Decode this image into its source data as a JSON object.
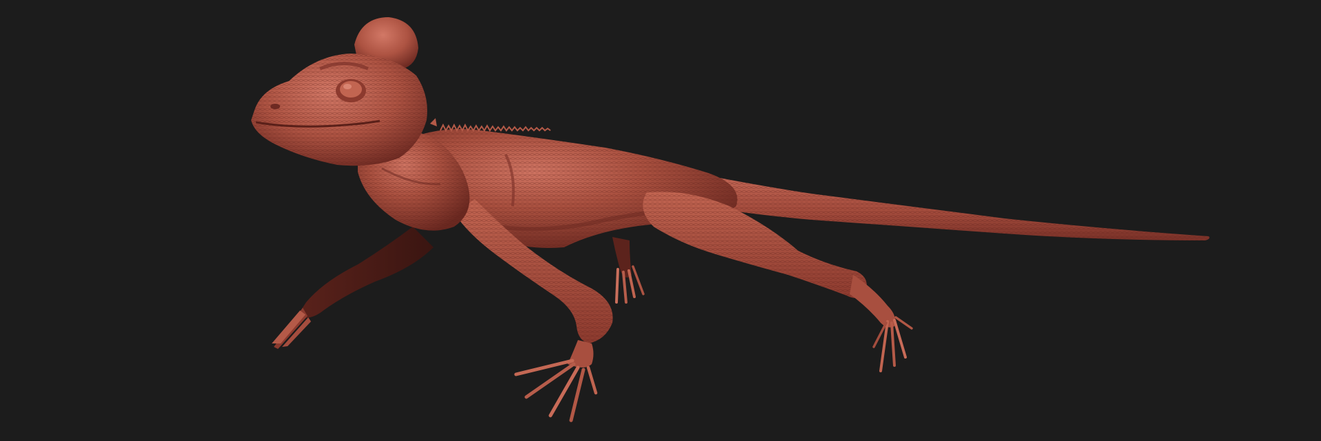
{
  "scene": {
    "subject": "lizard-sculpt",
    "background_color": "#1c1c1c",
    "colors": {
      "clay_light": "#c86a58",
      "clay_mid": "#a4493b",
      "clay_dark": "#6e2a22",
      "clay_shadow": "#3e1612",
      "highlight": "#de8d7b"
    }
  }
}
